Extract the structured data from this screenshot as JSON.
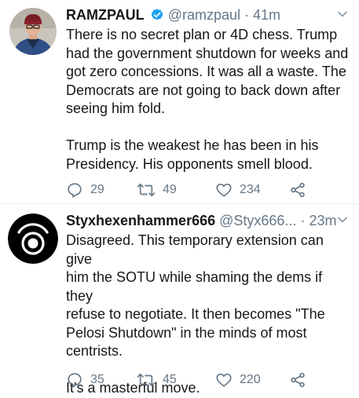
{
  "tweets": [
    {
      "display_name": "RAMZPAUL",
      "verified": true,
      "handle": "@ramzpaul",
      "separator": "·",
      "time": "41m",
      "paragraphs": [
        [
          "There is no secret plan or 4D chess. Trump",
          "had the government shutdown for weeks and",
          "got zero concessions. It was all a waste. The",
          "Democrats are not going to back down after",
          "seeing him fold."
        ],
        [
          "Trump is the weakest he has been in his",
          "Presidency. His opponents smell blood."
        ]
      ],
      "replies": "29",
      "retweets": "49",
      "likes": "234"
    },
    {
      "display_name": "Styxhexenhammer666",
      "verified": false,
      "handle": "@Styx666...",
      "separator": "·",
      "time": "23m",
      "paragraphs": [
        [
          "Disagreed. This temporary extension can give",
          "him the SOTU while shaming the dems if they",
          "refuse to negotiate. It then becomes \"The",
          "Pelosi Shutdown\" in the minds of most",
          "centrists."
        ],
        [
          "It's a masterful move."
        ]
      ],
      "replies": "35",
      "retweets": "45",
      "likes": "220"
    }
  ],
  "icons": {
    "reply": "reply-icon",
    "retweet": "retweet-icon",
    "like": "heart-icon",
    "share": "share-icon",
    "menu": "chevron-down-icon",
    "verified": "verified-badge-icon"
  },
  "colors": {
    "text": "#14171a",
    "secondary": "#657786",
    "verified_blue": "#1da1f2",
    "divider": "#e6ecf0"
  }
}
